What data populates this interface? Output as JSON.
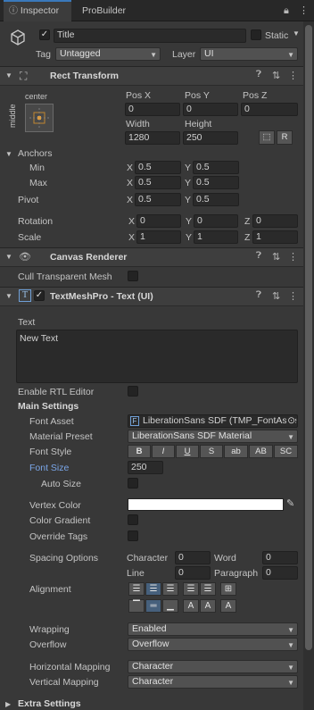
{
  "tabs": [
    {
      "label": "Inspector",
      "active": true
    },
    {
      "label": "ProBuilder",
      "active": false
    }
  ],
  "object": {
    "name": "Title",
    "active": true,
    "static_label": "Static",
    "tag_label": "Tag",
    "tag_value": "Untagged",
    "layer_label": "Layer",
    "layer_value": "UI"
  },
  "rect_transform": {
    "title": "Rect Transform",
    "anchor_top": "center",
    "anchor_side": "middle",
    "pos_labels": [
      "Pos X",
      "Pos Y",
      "Pos Z"
    ],
    "pos_values": [
      "0",
      "0",
      "0"
    ],
    "width_label": "Width",
    "height_label": "Height",
    "width": "1280",
    "height": "250",
    "anchors_label": "Anchors",
    "min_label": "Min",
    "min_x": "0.5",
    "min_y": "0.5",
    "max_label": "Max",
    "max_x": "0.5",
    "max_y": "0.5",
    "pivot_label": "Pivot",
    "pivot_x": "0.5",
    "pivot_y": "0.5",
    "rotation_label": "Rotation",
    "rotation": [
      "0",
      "0",
      "0"
    ],
    "scale_label": "Scale",
    "scale": [
      "1",
      "1",
      "1"
    ],
    "axis": [
      "X",
      "Y",
      "Z"
    ]
  },
  "canvas_renderer": {
    "title": "Canvas Renderer",
    "cull_label": "Cull Transparent Mesh"
  },
  "tmp": {
    "title": "TextMeshPro - Text (UI)",
    "text_label": "Text",
    "text_value": "New Text",
    "rtl_label": "Enable RTL Editor",
    "main_settings": "Main Settings",
    "font_asset_label": "Font Asset",
    "font_asset_value": "LiberationSans SDF (TMP_FontAsset)",
    "material_label": "Material Preset",
    "material_value": "LiberationSans SDF Material",
    "font_style_label": "Font Style",
    "font_styles": [
      "B",
      "I",
      "U",
      "S",
      "ab",
      "AB",
      "SC"
    ],
    "font_size_label": "Font Size",
    "font_size_value": "250",
    "auto_size_label": "Auto Size",
    "vertex_color_label": "Vertex Color",
    "color_gradient_label": "Color Gradient",
    "override_tags_label": "Override Tags",
    "spacing_label": "Spacing Options",
    "character_label": "Character",
    "character_value": "0",
    "word_label": "Word",
    "word_value": "0",
    "line_label": "Line",
    "line_value": "0",
    "paragraph_label": "Paragraph",
    "paragraph_value": "0",
    "alignment_label": "Alignment",
    "wrapping_label": "Wrapping",
    "wrapping_value": "Enabled",
    "overflow_label": "Overflow",
    "overflow_value": "Overflow",
    "hmap_label": "Horizontal Mapping",
    "hmap_value": "Character",
    "vmap_label": "Vertical Mapping",
    "vmap_value": "Character",
    "extra_settings": "Extra Settings"
  },
  "colors": {
    "accent": "#3a79bb",
    "font_size_label": "#7aa6e8",
    "vertex_color": "#ffffff"
  }
}
